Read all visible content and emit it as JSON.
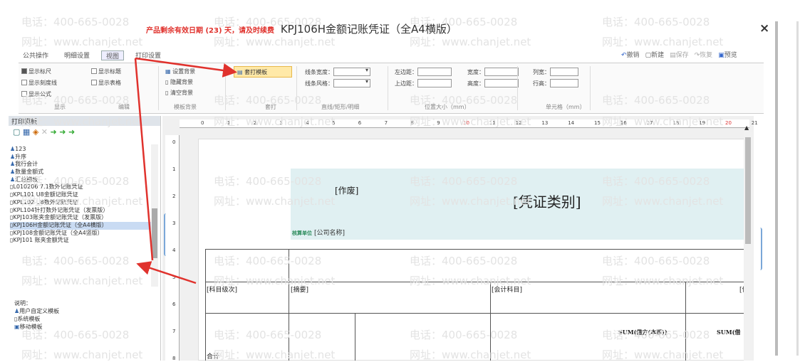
{
  "window": {
    "expiry_warning": "产品剩余有效日期 (23) 天，请及时续费",
    "title": "KPJ106H金额记账凭证（全A4横版）",
    "close": "×"
  },
  "tabs": [
    "公共操作",
    "明细设置",
    "视图",
    "打印设置"
  ],
  "top_actions": [
    "撤销",
    "新建",
    "保存",
    "恢复",
    "预览"
  ],
  "ribbon": {
    "display": {
      "show_ruler": "显示标尺",
      "show_title": "显示标题",
      "show_scale": "显示刻度线",
      "show_table": "显示表格",
      "show_formula": "显示公式",
      "group": "显示"
    },
    "edit_group": "编辑",
    "bg": {
      "set": "设置背景",
      "hide": "隐藏背景",
      "clear": "清空背景",
      "group": "模板背景"
    },
    "print": {
      "btn": "套打模板",
      "group": "套打"
    },
    "line": {
      "width": "线条宽度：",
      "style": "线条风格：",
      "group": "直线/矩形/明细"
    },
    "position": {
      "left": "左边距：",
      "top": "上边距：",
      "width": "宽度：",
      "height": "高度：",
      "group": "位置大小（mm）"
    },
    "cell": {
      "colw": "列宽：",
      "rowh": "行高：",
      "group": "单元格（mm）"
    }
  },
  "sidebar": {
    "header": "打印模板",
    "items": [
      "123",
      "升序",
      "我行会计",
      "数量金额式",
      "汇总模板",
      "L010206 7.1数外记账凭证",
      "KPL101 U8金额记账凭证",
      "KPL102 U8数外记账凭证",
      "KPL104针打数外记账凭证（发票版）",
      "KPJ103账夹金额记账凭证（发票版）",
      "KPJ106H金额记账凭证（全A4横版）",
      "KPJ108金额记账凭证（全A4竖版）",
      "KPJ101 账夹金额凭证"
    ],
    "legend_title": "说明：",
    "legend": [
      "用户自定义模板",
      "系统模板",
      "移动模板"
    ]
  },
  "ruler": {
    "h": [
      "0",
      "1",
      "2",
      "3",
      "4",
      "5",
      "6",
      "7",
      "8",
      "9",
      "10",
      "11",
      "12",
      "13",
      "14",
      "15",
      "16",
      "17",
      "18",
      "19",
      "20",
      "21"
    ],
    "v": [
      "0",
      "1",
      "2",
      "3",
      "4",
      "5",
      "6",
      "7",
      "8"
    ]
  },
  "voucher": {
    "void": "[作废]",
    "type": "[凭证类别]",
    "unit_label": "核算单位",
    "unit_value": "[公司名称]",
    "col_subject_level": "[科目级次]",
    "col_summary": "[摘要]",
    "col_account": "[会计科目]",
    "col_cut": "[信",
    "sum_debit": "SUM(借方(本币))",
    "sum_cut": "SUM(借",
    "total": "合计"
  },
  "watermark": {
    "phone": "电话：400-665-0028",
    "site": "网址：www.chanjet.net"
  }
}
